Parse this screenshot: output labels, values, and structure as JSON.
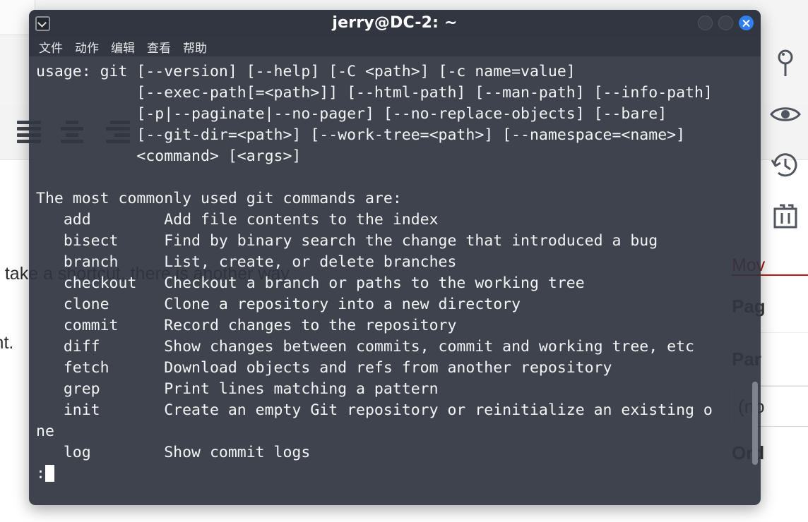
{
  "window": {
    "title": "jerry@DC-2: ~",
    "app_icon": "terminal-icon",
    "controls": {
      "minimize": "minimize",
      "maximize": "maximize",
      "close": "close"
    }
  },
  "menubar": {
    "items": [
      {
        "label": "文件"
      },
      {
        "label": "动作"
      },
      {
        "label": "编辑"
      },
      {
        "label": "查看"
      },
      {
        "label": "帮助"
      }
    ]
  },
  "terminal": {
    "lines": [
      "usage: git [--version] [--help] [-C <path>] [-c name=value]",
      "           [--exec-path[=<path>]] [--html-path] [--man-path] [--info-path]",
      "           [-p|--paginate|--no-pager] [--no-replace-objects] [--bare]",
      "           [--git-dir=<path>] [--work-tree=<path>] [--namespace=<name>]",
      "           <command> [<args>]",
      "",
      "The most commonly used git commands are:",
      "   add        Add file contents to the index",
      "   bisect     Find by binary search the change that introduced a bug",
      "   branch     List, create, or delete branches",
      "   checkout   Checkout a branch or paths to the working tree",
      "   clone      Clone a repository into a new directory",
      "   commit     Record changes to the repository",
      "   diff       Show changes between commits, commit and working tree, etc",
      "   fetch      Download objects and refs from another repository",
      "   grep       Print lines matching a pattern",
      "   init       Create an empty Git repository or reinitialize an existing o",
      "ne",
      "   log        Show commit logs"
    ],
    "pager_prompt": ":",
    "cursor": "block"
  },
  "background": {
    "body_text": [
      "d take a shortcut, there is another way",
      "int."
    ],
    "toolbar_icons": [
      {
        "name": "hamburger-menu-icon"
      },
      {
        "name": "align-left-icon"
      },
      {
        "name": "align-center-icon"
      },
      {
        "name": "align-right-icon"
      }
    ],
    "rail_icons": [
      {
        "name": "map-pin-icon"
      },
      {
        "name": "eye-icon"
      },
      {
        "name": "history-clock-icon"
      },
      {
        "name": "trash-icon"
      }
    ],
    "right_rows": [
      {
        "label": "Mov",
        "style": "link"
      },
      {
        "label": "Pag",
        "style": "bold"
      },
      {
        "label": "Par",
        "style": "bold"
      },
      {
        "label": "(no",
        "style": "boxed"
      },
      {
        "label": "Ord",
        "style": "last"
      }
    ]
  },
  "colors": {
    "terminal_bg": "#303540",
    "terminal_fg": "#f2f3f4",
    "titlebar_bg": "#30353f",
    "close_button": "#2f7ff0",
    "link_red": "#a41313",
    "background_page": "#ffffff"
  }
}
